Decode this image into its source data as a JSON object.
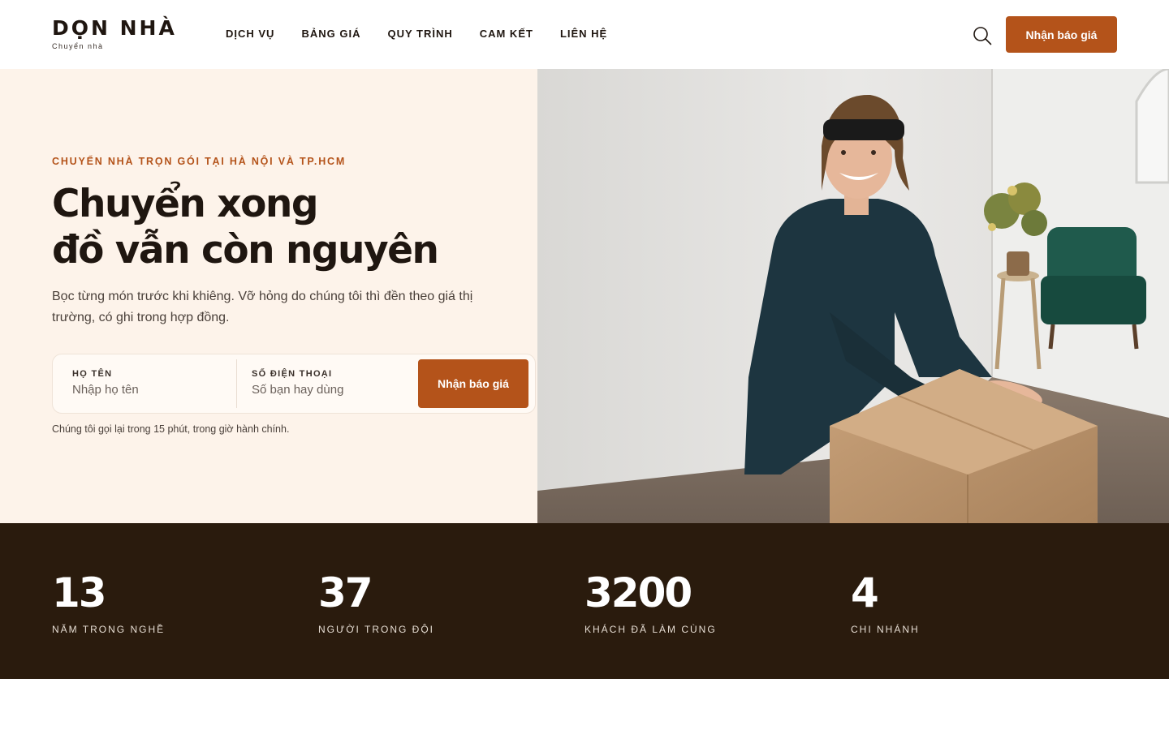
{
  "brand": {
    "name": "DỌN NHÀ",
    "tagline": "Chuyển nhà"
  },
  "nav": {
    "items": [
      {
        "label": "DỊCH VỤ"
      },
      {
        "label": "BẢNG GIÁ"
      },
      {
        "label": "QUY TRÌNH"
      },
      {
        "label": "CAM KẾT"
      },
      {
        "label": "LIÊN HỆ"
      }
    ],
    "search_icon": "search-icon",
    "cta_label": "Nhận báo giá"
  },
  "hero": {
    "eyebrow": "CHUYỂN NHÀ TRỌN GÓI TẠI HÀ NỘI VÀ TP.HCM",
    "headline_line1": "Chuyển xong",
    "headline_line2": "đồ vẫn còn nguyên",
    "lead": "Bọc từng món trước khi khiêng. Vỡ hỏng do chúng tôi thì đền theo giá thị trường, có ghi trong hợp đồng.",
    "form": {
      "name_label": "HỌ TÊN",
      "name_placeholder": "Nhập họ tên",
      "name_value": "",
      "phone_label": "SỐ ĐIỆN THOẠI",
      "phone_placeholder": "Số bạn hay dùng",
      "phone_value": "",
      "submit_label": "Nhận báo giá"
    },
    "note": "Chúng tôi gọi lại trong 15 phút, trong giờ hành chính."
  },
  "stats": [
    {
      "value": "13",
      "label": "NĂM TRONG NGHỀ"
    },
    {
      "value": "37",
      "label": "NGƯỜI TRONG ĐỘI"
    },
    {
      "value": "3200",
      "label": "KHÁCH ĐÃ LÀM CÙNG"
    },
    {
      "value": "4",
      "label": "CHI NHÁNH"
    }
  ],
  "colors": {
    "accent": "#b4531a",
    "hero_bg": "#fdf3ea",
    "stats_bg": "#2a1b0d",
    "text_dark": "#1f1610"
  }
}
